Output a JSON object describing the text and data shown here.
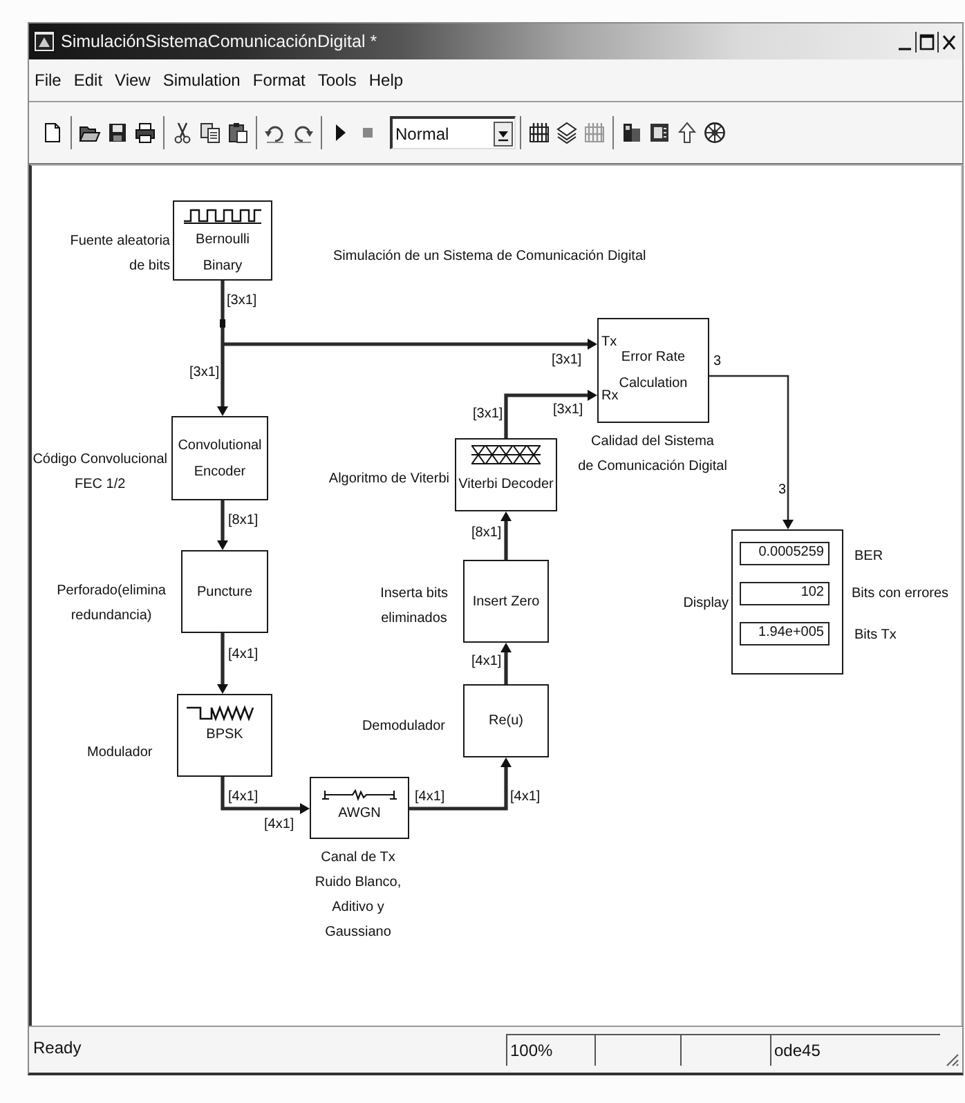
{
  "window": {
    "title": "SimulaciónSistemaComunicaciónDigital *"
  },
  "menu": [
    "File",
    "Edit",
    "View",
    "Simulation",
    "Format",
    "Tools",
    "Help"
  ],
  "toolbar": {
    "mode": "Normal"
  },
  "diagram": {
    "title": "Simulación de un Sistema de Comunicación Digital",
    "blocks": [
      {
        "kind": "source",
        "text": "Bernoulli\nBinary",
        "caption": "Fuente aleatoria\nde bits"
      },
      {
        "kind": "encoder",
        "text": "Convolutional\nEncoder",
        "caption": "Código Convolucional\nFEC 1/2"
      },
      {
        "kind": "decoder",
        "text": "Viterbi Decoder",
        "caption": "Algoritmo de Viterbi"
      },
      {
        "kind": "error_rate",
        "text": "Error Rate\nCalculation",
        "ports": [
          "Tx",
          "Rx"
        ],
        "caption": "Calidad del Sistema\nde Comunicación Digital"
      },
      {
        "kind": "puncture",
        "text": "Puncture",
        "caption": "Perforado(elimina\nredundancia)"
      },
      {
        "kind": "inserter",
        "text": "Insert Zero",
        "caption": "Inserta bits\neliminados"
      },
      {
        "kind": "display",
        "fields": [
          {
            "value": "0.0005259",
            "label": "BER"
          },
          {
            "value": "102",
            "label": "Bits con errores"
          },
          {
            "value": "1.94e+005",
            "label": "Bits Tx"
          }
        ],
        "caption": "Display"
      },
      {
        "kind": "modulator",
        "text": "BPSK",
        "caption": "Modulador"
      },
      {
        "kind": "demodulator",
        "text": "Re(u)",
        "caption": "Demodulador"
      },
      {
        "kind": "channel",
        "text": "AWGN",
        "caption": "Canal de Tx\nRuido Blanco,\nAditivo y\nGaussiano"
      }
    ],
    "signals": [
      {
        "labels": [
          "[3x1]",
          "[3x1]"
        ]
      },
      {
        "labels": [
          "[3x1]"
        ]
      },
      {
        "labels": [
          "[3x1]",
          "[3x1]"
        ]
      },
      {
        "labels": [
          "[8x1]"
        ]
      },
      {
        "labels": [
          "[8x1]"
        ]
      },
      {
        "labels": [
          "3",
          "3"
        ]
      },
      {
        "labels": [
          "[4x1]"
        ]
      },
      {
        "labels": [
          "[4x1]"
        ]
      },
      {
        "labels": [
          "[4x1]",
          "[4x1]"
        ]
      },
      {
        "labels": [
          "[4x1]",
          "[4x1]"
        ]
      }
    ]
  },
  "status_bar": {
    "message": "Ready",
    "zoom": "100%",
    "solver": "ode45"
  }
}
